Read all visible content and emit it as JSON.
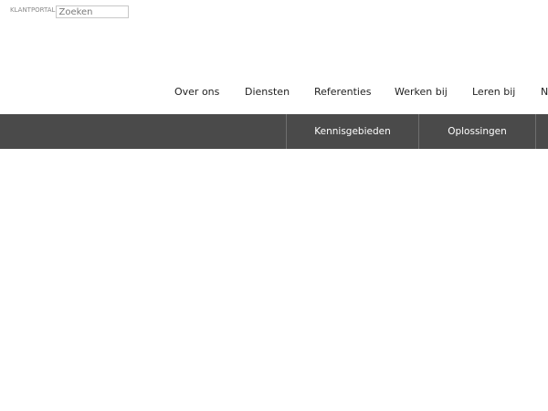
{
  "header": {
    "portal_label": "KLANTPORTAL",
    "search_placeholder": "Zoeken"
  },
  "main_nav": {
    "items": [
      {
        "label": "Over ons"
      },
      {
        "label": "Diensten"
      },
      {
        "label": "Referenties"
      },
      {
        "label": "Werken bij"
      },
      {
        "label": "Leren bij"
      },
      {
        "label": "N"
      }
    ]
  },
  "sub_nav": {
    "items": [
      {
        "label": "Kennisgebieden"
      },
      {
        "label": "Oplossingen"
      }
    ]
  },
  "colors": {
    "sub_bar_background": "#4a4a4a",
    "divider": "#6e6e6e",
    "nav_text": "#222222"
  }
}
